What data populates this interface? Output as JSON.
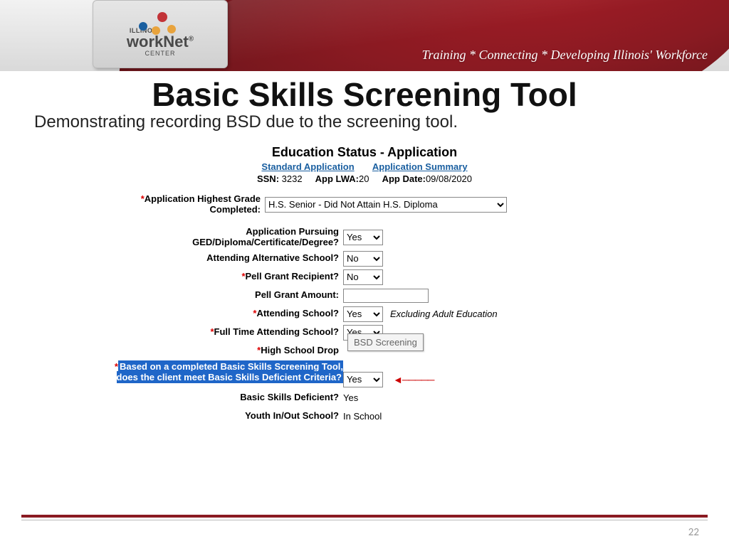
{
  "banner": {
    "tagline": "Training * Connecting * Developing Illinois' Workforce",
    "logo_line1": "ILLINOIS",
    "logo_main": "workNet",
    "logo_reg": "®",
    "logo_sub": "CENTER"
  },
  "slide": {
    "title": "Basic Skills Screening Tool",
    "subtitle": "Demonstrating recording BSD due to the screening tool."
  },
  "form": {
    "title": "Education Status - Application",
    "link_standard": "Standard Application",
    "link_summary": "Application Summary",
    "ssn_label": "SSN:",
    "ssn_value": "3232",
    "lwa_label": "App LWA:",
    "lwa_value": "20",
    "date_label": "App Date:",
    "date_value": "09/08/2020",
    "rows": {
      "grade_label": "Application Highest Grade Completed:",
      "grade_value": "H.S. Senior - Did Not Attain H.S. Diploma",
      "pursuing_label": "Application Pursuing GED/Diploma/Certificate/Degree?",
      "pursuing_value": "Yes",
      "alt_label": "Attending Alternative School?",
      "alt_value": "No",
      "pell_label": "Pell Grant Recipient?",
      "pell_value": "No",
      "pell_amt_label": "Pell Grant Amount:",
      "pell_amt_value": "",
      "attend_label": "Attending School?",
      "attend_value": "Yes",
      "attend_note": "Excluding Adult Education",
      "ft_label": "Full Time Attending School?",
      "ft_value": "Yes",
      "drop_label": "High School Drop",
      "drop_tooltip": "BSD Screening",
      "criteria_label": "Based on a completed Basic Skills Screening Tool, does the client meet Basic Skills Deficient Criteria?",
      "criteria_value": "Yes",
      "bsd_label": "Basic Skills Deficient?",
      "bsd_value": "Yes",
      "youth_label": "Youth In/Out School?",
      "youth_value": "In School"
    }
  },
  "footer": {
    "page": "22"
  }
}
